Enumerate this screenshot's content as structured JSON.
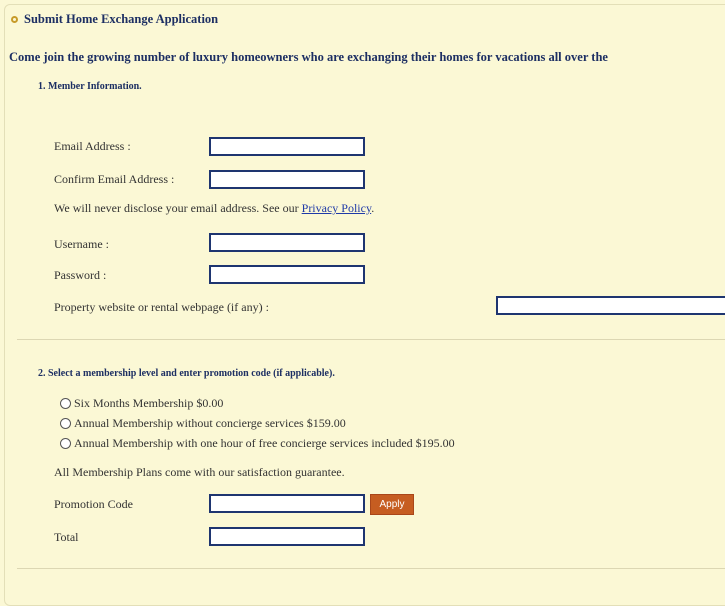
{
  "header": {
    "title": "Submit Home Exchange Application"
  },
  "intro": {
    "text": "Come join the growing number of luxury homeowners who are exchanging their homes for vacations all over the"
  },
  "section1": {
    "title": "1. Member Information.",
    "email_label": "Email Address :",
    "confirm_email_label": "Confirm Email Address :",
    "privacy_text": "We will never disclose your email address.  See our ",
    "privacy_link": "Privacy Policy",
    "privacy_end": ".",
    "username_label": "Username :",
    "password_label": "Password :",
    "website_label": "Property website or rental webpage (if any) :"
  },
  "section2": {
    "title": "2. Select a membership level and enter promotion code (if applicable).",
    "options": [
      "Six Months Membership $0.00",
      "Annual Membership without concierge services $159.00",
      "Annual Membership with one hour of free concierge services included $195.00"
    ],
    "guarantee": "All Membership Plans come with our satisfaction guarantee.",
    "promo_label": "Promotion Code",
    "apply_label": "Apply",
    "total_label": "Total"
  },
  "colors": {
    "background": "#fbf8d5",
    "heading": "#1d2f63",
    "field_border": "#1e3570",
    "apply_button": "#c65d21",
    "link": "#1f3aa8"
  }
}
